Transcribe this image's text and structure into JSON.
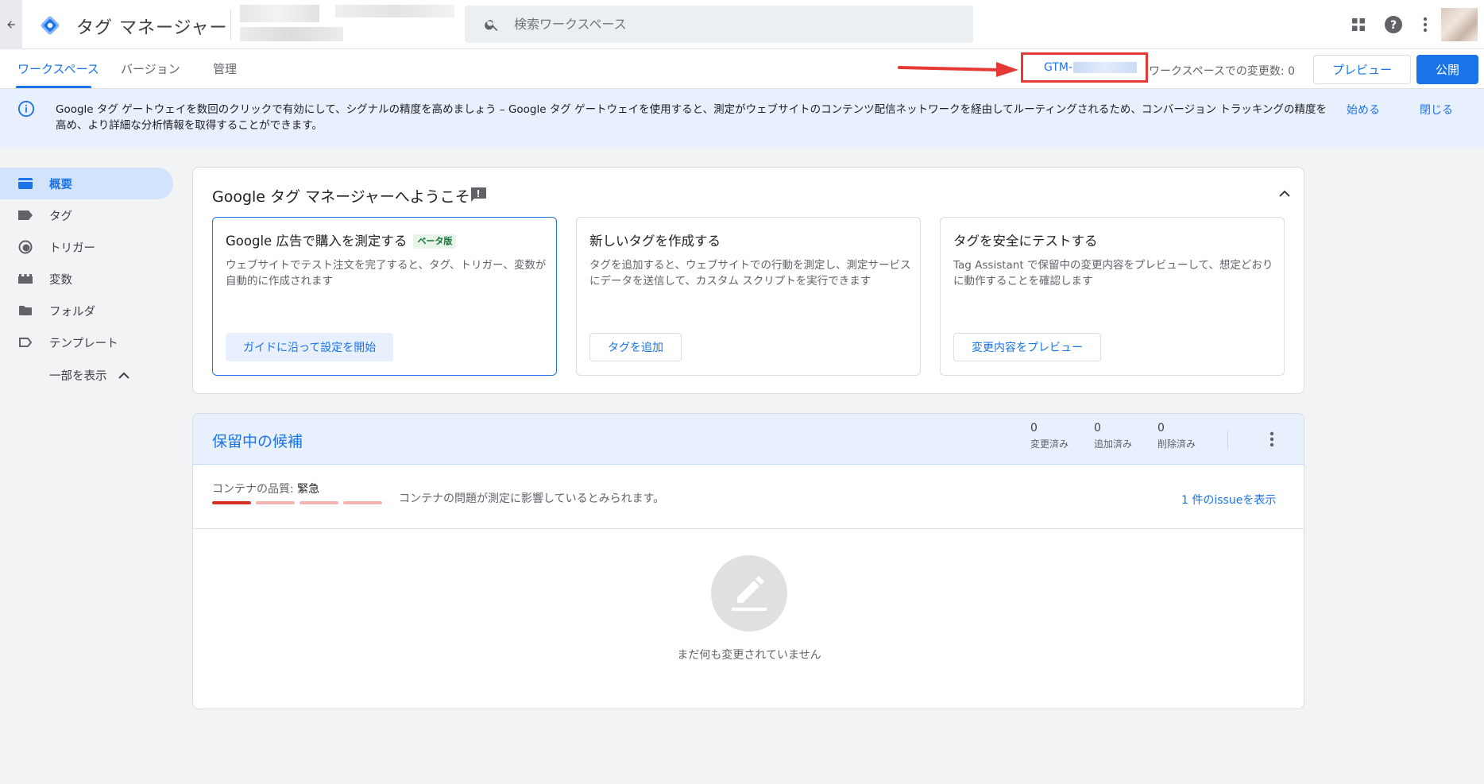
{
  "header": {
    "back_icon": "arrow-back-icon",
    "app_title": "タグ マネージャー",
    "search_placeholder": "検索ワークスペース",
    "apps_icon": "apps-grid-icon",
    "help_icon": "help-icon",
    "more_icon": "more-vert-icon"
  },
  "tabs": [
    {
      "label": "ワークスペース",
      "active": true
    },
    {
      "label": "バージョン",
      "active": false
    },
    {
      "label": "管理",
      "active": false
    }
  ],
  "toolbar": {
    "container_id": "GTM-",
    "workspace_changes": "ワークスペースでの変更数: 0",
    "preview_label": "プレビュー",
    "publish_label": "公開"
  },
  "banner": {
    "text": "Google タグ ゲートウェイを数回のクリックで有効にして、シグナルの精度を高めましょう – Google タグ ゲートウェイを使用すると、測定がウェブサイトのコンテンツ配信ネットワークを経由してルーティングされるため、コンバージョン トラッキングの精度を高め、より詳細な分析情報を取得することができます。",
    "start_label": "始める",
    "close_label": "閉じる"
  },
  "sidebar": {
    "items": [
      {
        "label": "概要",
        "icon": "overview-icon",
        "active": true
      },
      {
        "label": "タグ",
        "icon": "tag-icon",
        "active": false
      },
      {
        "label": "トリガー",
        "icon": "trigger-icon",
        "active": false
      },
      {
        "label": "変数",
        "icon": "variables-icon",
        "active": false
      },
      {
        "label": "フォルダ",
        "icon": "folder-icon",
        "active": false
      },
      {
        "label": "テンプレート",
        "icon": "template-icon",
        "active": false
      }
    ],
    "show_less_label": "一部を表示"
  },
  "welcome": {
    "title": "Google タグ マネージャーへようこそ",
    "cards": [
      {
        "title": "Google 広告で購入を測定する",
        "badge": "ベータ版",
        "description": "ウェブサイトでテスト注文を完了すると、タグ、トリガー、変数が自動的に作成されます",
        "button": "ガイドに沿って設定を開始"
      },
      {
        "title": "新しいタグを作成する",
        "description": "タグを追加すると、ウェブサイトでの行動を測定し、測定サービスにデータを送信して、カスタム スクリプトを実行できます",
        "button": "タグを追加"
      },
      {
        "title": "タグを安全にテストする",
        "description": "Tag Assistant で保留中の変更内容をプレビューして、想定どおりに動作することを確認します",
        "button": "変更内容をプレビュー"
      }
    ]
  },
  "pending": {
    "title": "保留中の候補",
    "stats": [
      {
        "value": "0",
        "label": "変更済み"
      },
      {
        "value": "0",
        "label": "追加済み"
      },
      {
        "value": "0",
        "label": "削除済み"
      }
    ],
    "quality_label": "コンテナの品質: ",
    "quality_value": "緊急",
    "quality_level": 1,
    "quality_levels_total": 4,
    "quality_message": "コンテナの問題が測定に影響しているとみられます。",
    "issue_link": "1 件のissueを表示",
    "empty_text": "まだ何も変更されていません"
  },
  "colors": {
    "accent": "#1a73e8",
    "danger": "#d93025",
    "annotation_red": "#e53935"
  }
}
